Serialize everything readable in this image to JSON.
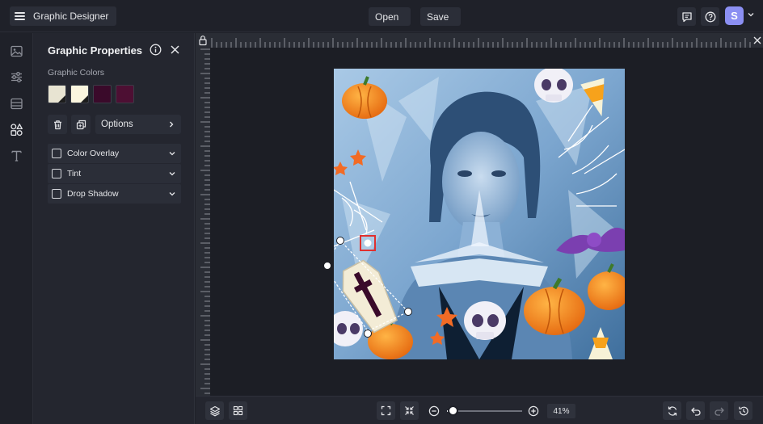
{
  "app": {
    "title": "Graphic Designer"
  },
  "toolbar": {
    "open_label": "Open",
    "save_label": "Save",
    "user_initial": "S"
  },
  "panel": {
    "title": "Graphic Properties",
    "colors_label": "Graphic Colors",
    "swatches": [
      "#e8e4d2",
      "#fbf6df",
      "#3a0a2a",
      "#4d0f33"
    ],
    "options_label": "Options",
    "effects": [
      {
        "label": "Color Overlay",
        "checked": false
      },
      {
        "label": "Tint",
        "checked": false
      },
      {
        "label": "Drop Shadow",
        "checked": false
      }
    ]
  },
  "zoom": {
    "label": "41%",
    "value": 0.05
  },
  "icons": {
    "rail": [
      "image-icon",
      "sliders-icon",
      "layout-icon",
      "shapes-icon",
      "text-icon"
    ],
    "bottom_left": [
      "layers-icon",
      "grid-icon"
    ],
    "bottom_center": [
      "fit-screen-icon",
      "shrink-icon",
      "zoom-out-icon",
      "zoom-in-icon"
    ],
    "bottom_right": [
      "flip-icon",
      "undo-icon",
      "redo-icon",
      "history-icon"
    ]
  },
  "colors": {
    "accent": "#8b8ff2",
    "background": "#1f2129",
    "panel": "#24262f",
    "selection": "#e0302f"
  }
}
